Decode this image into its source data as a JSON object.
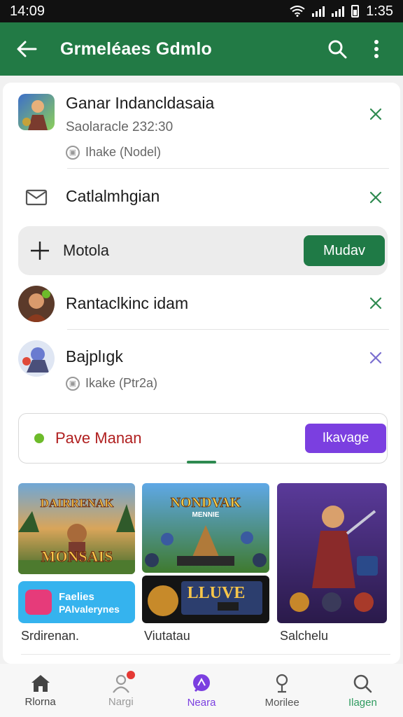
{
  "status_bar": {
    "time": "14:09",
    "clock_right": "1:35"
  },
  "app_bar": {
    "title": "Grmeléaes Gdmlo"
  },
  "list": [
    {
      "name": "Ganar Indancldasaia",
      "subtitle": "Saolaracle 232:30",
      "meta": "Ihake (Nodel)",
      "icon": "game-thumbnail",
      "action": "close-icon"
    },
    {
      "name": "Catlalmhgian",
      "icon": "mail-icon",
      "action": "close-icon"
    },
    {
      "name": "Rantaclkinc idam",
      "icon": "avatar",
      "action": "close-icon"
    },
    {
      "name": "Bajplıgk",
      "meta": "Ikake (Ptr2a)",
      "icon": "avatar",
      "action": "close-icon"
    }
  ],
  "input_row": {
    "label": "Motola",
    "button": "Mudav"
  },
  "promo": {
    "label": "Pave Manan",
    "button": "Ikavage"
  },
  "tiles": [
    {
      "title_line1": "DAIRRENAK",
      "title_line2": "MONSAIS",
      "caption": "Srdirenan."
    },
    {
      "title_line1": "NONDVAK",
      "subtitle": "MENNIE",
      "bottom_banner": "LLUVE",
      "caption": "Viutatau"
    },
    {
      "caption": "Salchelu"
    }
  ],
  "promo_tile": {
    "line1": "Faelies",
    "line2": "PAlvalerynes"
  },
  "bottom_nav": [
    {
      "label": "Rlorna",
      "icon": "home-icon",
      "color": "#444444"
    },
    {
      "label": "Nargi",
      "icon": "profile-icon",
      "color": "#9a9a9a"
    },
    {
      "label": "Neara",
      "icon": "chat-icon",
      "color": "#7b3fe0"
    },
    {
      "label": "Morilee",
      "icon": "location-icon",
      "color": "#555555"
    },
    {
      "label": "Ilagen",
      "icon": "search-icon",
      "color": "#2e9b5f"
    }
  ],
  "colors": {
    "app_bar": "#227a45",
    "accent_green": "#1f7a46",
    "accent_purple": "#7b3fe0",
    "promo_text": "#b01f1f"
  }
}
